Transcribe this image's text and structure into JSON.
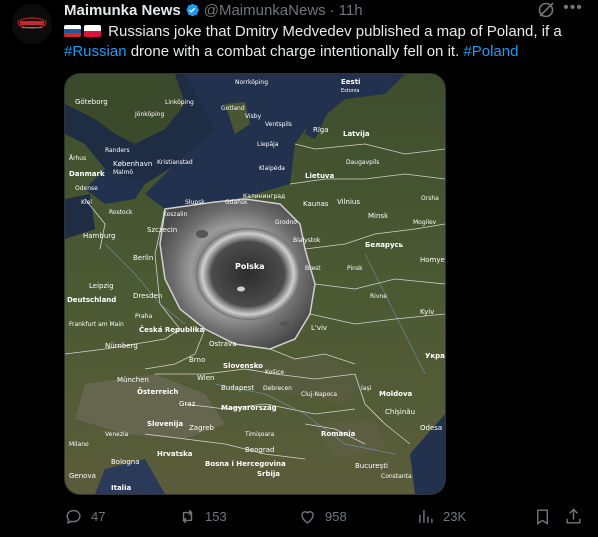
{
  "post": {
    "author_name": "Maimunka News",
    "handle": "@MaimunkaNews",
    "separator": "·",
    "time": "11h",
    "text_before": "Russians joke that Dmitry Medvedev published a map of Poland, if a ",
    "hashtag1": "#Russian",
    "text_middle": " drone with a combat charge intentionally fell on it. ",
    "hashtag2": "#Poland",
    "flags": [
      "russia-flag",
      "poland-flag"
    ]
  },
  "map": {
    "labels": {
      "polska": "Polska",
      "eesti": "Eesti",
      "estonia": "Estonia",
      "riga": "Rīga",
      "latvija": "Latvija",
      "lietuva": "Lietuva",
      "kaunas": "Kaunas",
      "vilnius": "Vilnius",
      "minsk": "Minsk",
      "belarus": "Беларусь",
      "goteborg": "Göteborg",
      "kobenhavn": "København",
      "danmark": "Danmark",
      "hamburg": "Hamburg",
      "berlin": "Berlin",
      "szczecin": "Szczecin",
      "deutschland": "Deutschland",
      "dresden": "Dresden",
      "leipzig": "Leipzig",
      "frankfurt": "Frankfurt am Main",
      "nurnberg": "Nürnberg",
      "munchen": "München",
      "ceska": "Česká Republika",
      "praha": "Praha",
      "ostrava": "Ostrava",
      "brno": "Brno",
      "wien": "Wien",
      "osterreich": "Österreich",
      "slovensko": "Slovensko",
      "budapest": "Budapest",
      "magyarorszag": "Magyarország",
      "graz": "Graz",
      "slovenija": "Slovenija",
      "zagreb": "Zagreb",
      "hrvatska": "Hrvatska",
      "bosna": "Bosna i Hercegovina",
      "srbija": "Srbija",
      "beograd": "Beograd",
      "romania": "Romania",
      "bucuresti": "București",
      "moldova": "Moldova",
      "chisinau": "Chișinău",
      "odesa": "Odesa",
      "kyiv": "Kyiv",
      "lviv": "L'viv",
      "ukraina": "Укра",
      "bologna": "Bologna",
      "italia": "Italia",
      "genova": "Genova",
      "milano": "Milano",
      "venezia": "Venezia",
      "daugavpils": "Daugavpils",
      "klaipeda": "Klaipėda",
      "kaliningrad": "Калининград",
      "kaunas2": "Grodno",
      "brest": "Brest",
      "pinsk": "Pinsk",
      "homyel": "Homyel",
      "rivne": "Rivne",
      "kosice": "Košice",
      "debrecen": "Debrecen",
      "cluj": "Cluj-Napoca",
      "timisoara": "Timișoara",
      "iasi": "Iași",
      "constanta": "Constanta",
      "gdansk": "Gdańsk",
      "koszalin": "Koszalin",
      "slupsk": "Słupsk",
      "bialystok": "Białystok",
      "rostock": "Rostock",
      "kiel": "Kiel",
      "malmo": "Malmö",
      "kristianstad": "Kristianstad",
      "jonkoping": "Jönköping",
      "linkoping": "Linköping",
      "norrkoping": "Norrköping",
      "gotland": "Gotland",
      "visby": "Visby",
      "liepaja": "Liepāja",
      "ventspils": "Ventspils",
      "aarhus": "Århus",
      "odense": "Odense",
      "randers": "Randers",
      "orsha": "Orsha",
      "mogilev": "Mogilev"
    }
  },
  "actions": {
    "replies": "47",
    "reposts": "153",
    "likes": "958",
    "views": "23K"
  },
  "colors": {
    "background": "#000000",
    "text": "#e7e9ea",
    "secondary": "#71767b",
    "link": "#1d9bf0",
    "verified": "#1d9bf0"
  }
}
